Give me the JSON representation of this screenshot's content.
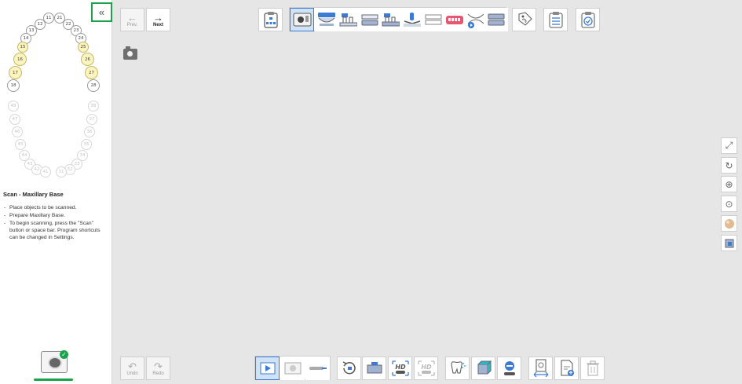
{
  "sidebar": {
    "collapse_label": "«",
    "teeth_upper": [
      {
        "num": "11",
        "hl": false
      },
      {
        "num": "21",
        "hl": false
      },
      {
        "num": "12",
        "hl": false
      },
      {
        "num": "22",
        "hl": false
      },
      {
        "num": "13",
        "hl": false
      },
      {
        "num": "23",
        "hl": false
      },
      {
        "num": "14",
        "hl": false
      },
      {
        "num": "24",
        "hl": false
      },
      {
        "num": "15",
        "hl": true
      },
      {
        "num": "25",
        "hl": true
      },
      {
        "num": "16",
        "hl": true
      },
      {
        "num": "26",
        "hl": true
      },
      {
        "num": "17",
        "hl": true
      },
      {
        "num": "27",
        "hl": true
      },
      {
        "num": "18",
        "hl": false
      },
      {
        "num": "28",
        "hl": false
      }
    ],
    "teeth_lower": [
      "48",
      "38",
      "47",
      "37",
      "46",
      "36",
      "45",
      "35",
      "44",
      "34",
      "43",
      "33",
      "42",
      "32",
      "41",
      "31"
    ],
    "info": {
      "title": "Scan - Maxillary Base",
      "items": [
        "Place objects to be scanned.",
        "Prepare Maxillary Base.",
        "To begin scanning, press the \"Scan\" button or space bar. Program shortcuts can be changed in Settings."
      ]
    }
  },
  "nav": {
    "prev_label": "Prev.",
    "next_label": "Next",
    "undo_label": "Undo",
    "redo_label": "Redo"
  },
  "top_toolbar": {
    "icons": [
      "clipboard-tree-icon",
      "scanner-base-icon",
      "maxilla-icon",
      "maxilla-abutment-icon",
      "mandible-icon",
      "mandible-abutment-icon",
      "tooth-arch-icon",
      "occlusion-icon",
      "gingiva-icon",
      "bite-play-icon",
      "occlusion-bite-icon",
      "tooth-tag-icon",
      "settings-sheet-icon",
      "check-clipboard-icon"
    ]
  },
  "bottom_toolbar": {
    "icons": [
      "scan-play-icon",
      "scan-settings-icon",
      "scanner-tip-icon",
      "reset-rotate-icon",
      "screenshot-icon",
      "hd-on-icon",
      "hd-off-icon",
      "tooth-spray-icon",
      "transform-cube-icon",
      "minus-toggle-icon",
      "snapshot-swap-icon",
      "export-doc-icon",
      "trash-icon"
    ]
  },
  "colors": {
    "accent_green": "#1aa34a",
    "selected_blue": "#3c7bd4",
    "highlight_yellow": "#fbf4bf"
  }
}
